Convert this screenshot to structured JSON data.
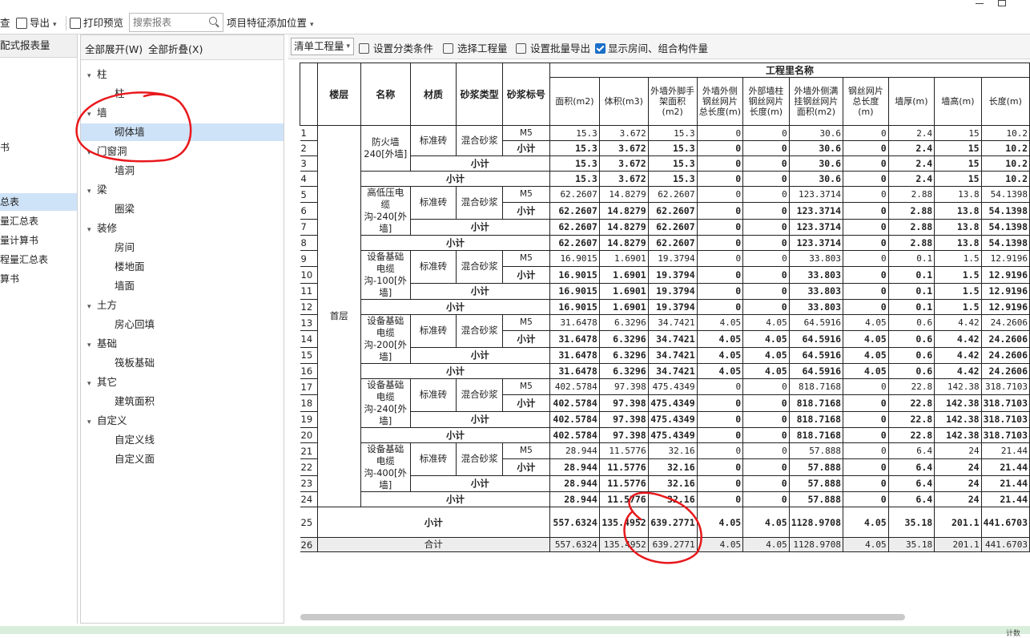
{
  "toolbar": {
    "view_label": "查",
    "export_label": "导出",
    "print_label": "打印预览",
    "search_placeholder": "搜索报表",
    "feature_label": "项目特征添加位置"
  },
  "left_panel": {
    "header": "配式报表量",
    "items": [
      "书",
      "总表",
      "量汇总表",
      "量计算书",
      "程量汇总表",
      "算书"
    ]
  },
  "tree": {
    "expand_all": "全部展开(W)",
    "collapse_all": "全部折叠(X)",
    "nodes": [
      {
        "label": "柱",
        "level": 0
      },
      {
        "label": "柱",
        "level": 1
      },
      {
        "label": "墙",
        "level": 0
      },
      {
        "label": "砌体墙",
        "level": 1,
        "selected": true
      },
      {
        "label": "门窗洞",
        "level": 0
      },
      {
        "label": "墙洞",
        "level": 1
      },
      {
        "label": "梁",
        "level": 0
      },
      {
        "label": "圈梁",
        "level": 1
      },
      {
        "label": "装修",
        "level": 0
      },
      {
        "label": "房间",
        "level": 1
      },
      {
        "label": "楼地面",
        "level": 1
      },
      {
        "label": "墙面",
        "level": 1
      },
      {
        "label": "土方",
        "level": 0
      },
      {
        "label": "房心回填",
        "level": 1
      },
      {
        "label": "基础",
        "level": 0
      },
      {
        "label": "筏板基础",
        "level": 1
      },
      {
        "label": "其它",
        "level": 0
      },
      {
        "label": "建筑面积",
        "level": 1
      },
      {
        "label": "自定义",
        "level": 0
      },
      {
        "label": "自定义线",
        "level": 1
      },
      {
        "label": "自定义面",
        "level": 1
      }
    ]
  },
  "rightbar": {
    "dropdown": "清单工程量",
    "set_category": "设置分类条件",
    "select_qty": "选择工程量",
    "set_batch_export": "设置批量导出",
    "show_rooms": "显示房间、组合构件量"
  },
  "table": {
    "group_header": "工程里名称",
    "headers": [
      "楼层",
      "名称",
      "材质",
      "砂浆类型",
      "砂浆标号"
    ],
    "qty_headers": [
      "面积(m2)",
      "体积(m3)",
      "外墙外脚手架面积(m2)",
      "外墙外侧钢丝网片总长度(m)",
      "外部墙柱钢丝网片长度(m)",
      "外墙外侧满挂钢丝网片面积(m2)",
      "钢丝网片总长度(m)",
      "墙厚(m)",
      "墙高(m)",
      "长度(m)"
    ],
    "floor": "首层",
    "mortar_type": "混合砂浆",
    "mortar_grade": "M5",
    "material": "标准砖",
    "subtotal": "小计",
    "total": "合计",
    "groups": [
      {
        "name": "防火墙240[外墙]",
        "m5": [
          "15.3",
          "3.672",
          "15.3",
          "0",
          "0",
          "30.6",
          "0",
          "2.4",
          "15",
          "10.2"
        ],
        "sub": [
          "15.3",
          "3.672",
          "15.3",
          "0",
          "0",
          "30.6",
          "0",
          "2.4",
          "15",
          "10.2"
        ]
      },
      {
        "name": "高低压电缆沟-240[外墙]",
        "m5": [
          "62.2607",
          "14.8279",
          "62.2607",
          "0",
          "0",
          "123.3714",
          "0",
          "2.88",
          "13.8",
          "54.1398"
        ],
        "sub": [
          "62.2607",
          "14.8279",
          "62.2607",
          "0",
          "0",
          "123.3714",
          "0",
          "2.88",
          "13.8",
          "54.1398"
        ]
      },
      {
        "name": "设备基础电缆沟-100[外墙]",
        "m5": [
          "16.9015",
          "1.6901",
          "19.3794",
          "0",
          "0",
          "33.803",
          "0",
          "0.1",
          "1.5",
          "12.9196"
        ],
        "sub": [
          "16.9015",
          "1.6901",
          "19.3794",
          "0",
          "0",
          "33.803",
          "0",
          "0.1",
          "1.5",
          "12.9196"
        ]
      },
      {
        "name": "设备基础电缆沟-200[外墙]",
        "m5": [
          "31.6478",
          "6.3296",
          "34.7421",
          "4.05",
          "4.05",
          "64.5916",
          "4.05",
          "0.6",
          "4.42",
          "24.2606"
        ],
        "sub": [
          "31.6478",
          "6.3296",
          "34.7421",
          "4.05",
          "4.05",
          "64.5916",
          "4.05",
          "0.6",
          "4.42",
          "24.2606"
        ]
      },
      {
        "name": "设备基础电缆沟-240[外墙]",
        "m5": [
          "402.5784",
          "97.398",
          "475.4349",
          "0",
          "0",
          "818.7168",
          "0",
          "22.8",
          "142.38",
          "318.7103"
        ],
        "sub": [
          "402.5784",
          "97.398",
          "475.4349",
          "0",
          "0",
          "818.7168",
          "0",
          "22.8",
          "142.38",
          "318.7103"
        ]
      },
      {
        "name": "设备基础电缆沟-400[外墙]",
        "m5": [
          "28.944",
          "11.5776",
          "32.16",
          "0",
          "0",
          "57.888",
          "0",
          "6.4",
          "24",
          "21.44"
        ],
        "sub": [
          "28.944",
          "11.5776",
          "32.16",
          "0",
          "0",
          "57.888",
          "0",
          "6.4",
          "24",
          "21.44"
        ]
      }
    ],
    "floor_subtotal": [
      "557.6324",
      "135.4952",
      "639.2771",
      "4.05",
      "4.05",
      "1128.9708",
      "4.05",
      "35.18",
      "201.1",
      "441.6703"
    ],
    "grand_total": [
      "557.6324",
      "135.4952",
      "639.2771",
      "4.05",
      "4.05",
      "1128.9708",
      "4.05",
      "35.18",
      "201.1",
      "441.6703"
    ]
  },
  "status": {
    "text": "计数"
  },
  "colors": {
    "selection": "#cfe3f8",
    "annotation": "#e8181c",
    "accent": "#1a6fc9"
  }
}
